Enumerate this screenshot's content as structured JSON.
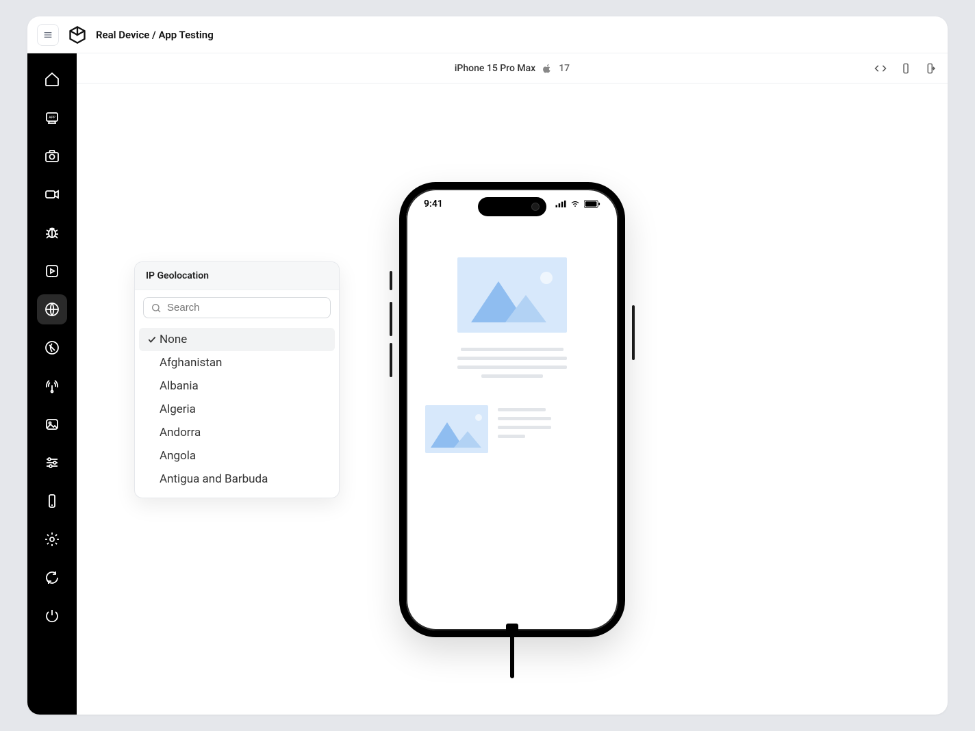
{
  "header": {
    "title": "Real Device / App Testing"
  },
  "toolbar": {
    "device_name": "iPhone 15 Pro Max",
    "os_version": "17"
  },
  "sidebar": {
    "icons": [
      "home-icon",
      "app-icon",
      "camera-icon",
      "video-icon",
      "bug-icon",
      "play-icon",
      "globe-icon",
      "map-icon",
      "network-icon",
      "image-icon",
      "sliders-icon",
      "device-icon",
      "settings-icon",
      "refresh-icon",
      "power-icon"
    ],
    "active_index": 6
  },
  "popover": {
    "title": "IP Geolocation",
    "search_placeholder": "Search",
    "selected": "None",
    "items": [
      "None",
      "Afghanistan",
      "Albania",
      "Algeria",
      "Andorra",
      "Angola",
      "Antigua and Barbuda"
    ]
  },
  "phone": {
    "time": "9:41"
  }
}
